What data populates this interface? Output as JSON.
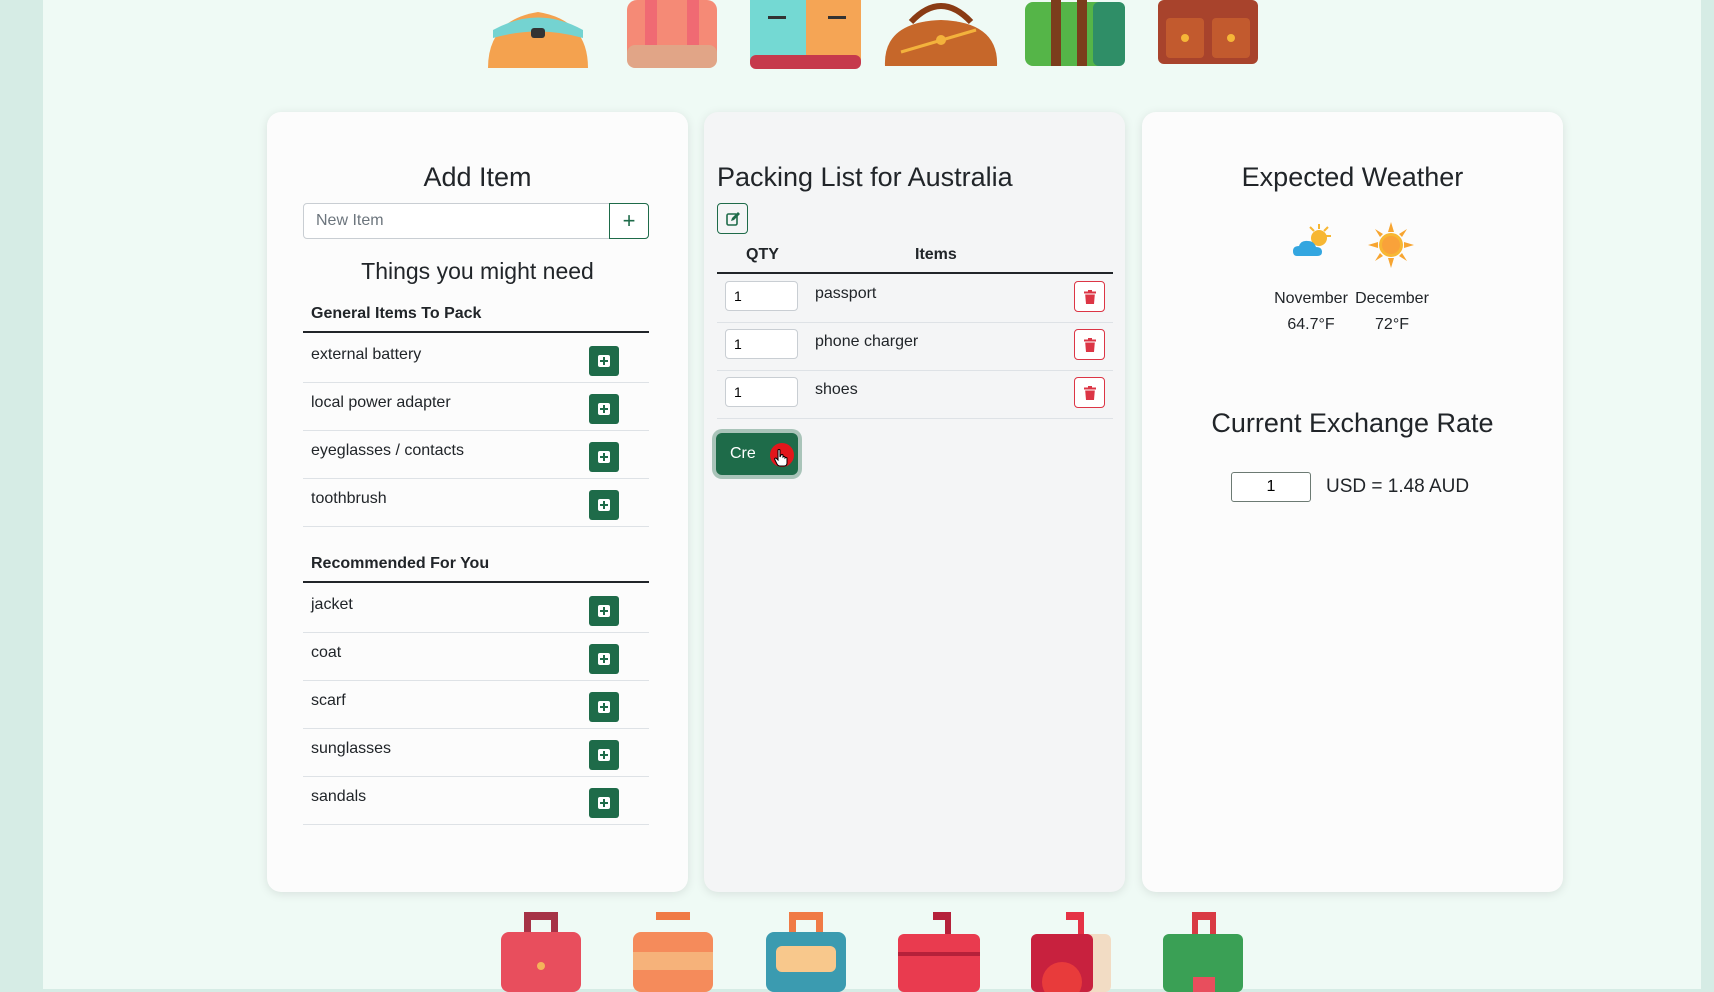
{
  "add_item": {
    "title": "Add Item",
    "input_placeholder": "New Item",
    "suggest_title": "Things you might need"
  },
  "general": {
    "heading": "General Items To Pack",
    "items": [
      "external battery",
      "local power adapter",
      "eyeglasses / contacts",
      "toothbrush"
    ]
  },
  "recommended": {
    "heading": "Recommended For You",
    "items": [
      "jacket",
      "coat",
      "scarf",
      "sunglasses",
      "sandals"
    ]
  },
  "packing": {
    "title": "Packing List for Australia",
    "col_qty": "QTY",
    "col_items": "Items",
    "rows": [
      {
        "qty": "1",
        "name": "passport"
      },
      {
        "qty": "1",
        "name": "phone charger"
      },
      {
        "qty": "1",
        "name": "shoes"
      }
    ],
    "create_label": "Cre"
  },
  "weather": {
    "title": "Expected Weather",
    "months": [
      {
        "month": "November",
        "temp": "64.7°F",
        "icon": "partly-cloudy-icon"
      },
      {
        "month": "December",
        "temp": "72°F",
        "icon": "sun-icon"
      }
    ]
  },
  "exchange": {
    "title": "Current Exchange Rate",
    "amount": "1",
    "rate_text": "USD = 1.48 AUD"
  },
  "colors": {
    "primary": "#1e6b49",
    "danger": "#dc3545",
    "background": "#effaf5"
  }
}
